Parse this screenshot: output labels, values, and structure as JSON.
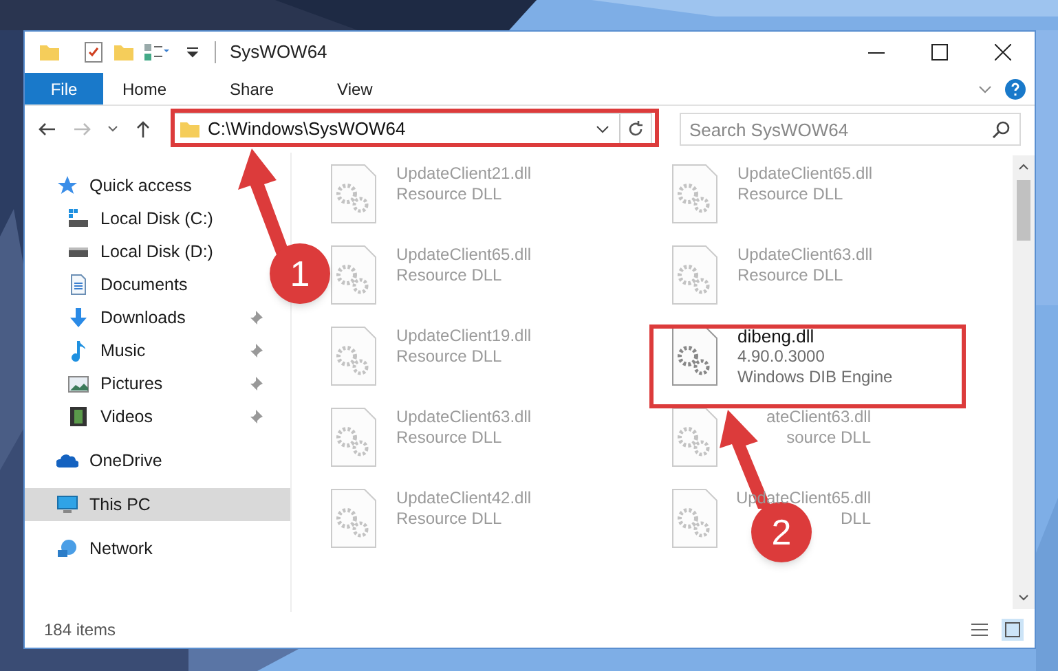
{
  "window": {
    "title": "SysWOW64"
  },
  "ribbon_tabs": [
    {
      "label": "File",
      "selected": true
    },
    {
      "label": "Home",
      "selected": false
    },
    {
      "label": "Share",
      "selected": false
    },
    {
      "label": "View",
      "selected": false
    }
  ],
  "address_bar": {
    "path": "C:\\Windows\\SysWOW64"
  },
  "search": {
    "placeholder": "Search SysWOW64"
  },
  "sidebar": {
    "items": [
      {
        "label": "Quick access",
        "kind": "star",
        "pinned": false,
        "selected": false,
        "children": [
          {
            "label": "Local Disk (C:)",
            "kind": "disk-c",
            "pinned": false,
            "selected": false
          },
          {
            "label": "Local Disk (D:)",
            "kind": "disk",
            "pinned": false,
            "selected": false
          },
          {
            "label": "Documents",
            "kind": "documents",
            "pinned": false,
            "selected": false
          },
          {
            "label": "Downloads",
            "kind": "downloads",
            "pinned": true,
            "selected": false
          },
          {
            "label": "Music",
            "kind": "music",
            "pinned": true,
            "selected": false
          },
          {
            "label": "Pictures",
            "kind": "pictures",
            "pinned": true,
            "selected": false
          },
          {
            "label": "Videos",
            "kind": "videos",
            "pinned": true,
            "selected": false
          }
        ]
      },
      {
        "label": "OneDrive",
        "kind": "cloud",
        "pinned": false,
        "selected": false
      },
      {
        "label": "This PC",
        "kind": "pc",
        "pinned": false,
        "selected": true
      },
      {
        "label": "Network",
        "kind": "network",
        "pinned": false,
        "selected": false
      }
    ]
  },
  "files": [
    {
      "name": "UpdateClient21.dll",
      "line_2": "Resource DLL",
      "faded": true,
      "covered": false
    },
    {
      "name": "UpdateClient65.dll",
      "line_2": "Resource DLL",
      "faded": true,
      "covered": false
    },
    {
      "name": "UpdateClient65.dll",
      "line_2": "Resource DLL",
      "faded": true,
      "covered": false
    },
    {
      "name": "UpdateClient63.dll",
      "line_2": "Resource DLL",
      "faded": true,
      "covered": false
    },
    {
      "name": "UpdateClient19.dll",
      "line_2": "Resource DLL",
      "faded": true,
      "covered": false
    },
    {
      "name": "dibeng.dll",
      "line_2": "4.90.0.3000",
      "line_3": "Windows DIB Engine",
      "faded": false,
      "covered": false
    },
    {
      "name": "UpdateClient63.dll",
      "line_2": "Resource DLL",
      "faded": true,
      "covered": false
    },
    {
      "name": "ateClient63.dll",
      "line_2": "source DLL",
      "faded": true,
      "covered": true
    },
    {
      "name": "UpdateClient42.dll",
      "line_2": "Resource DLL",
      "faded": true,
      "covered": false
    },
    {
      "name": "UpdateClient65.dll",
      "line_2": "DLL",
      "faded": true,
      "covered": true
    }
  ],
  "status_bar": {
    "item_count": "184 items"
  },
  "annotations": [
    {
      "number": "1"
    },
    {
      "number": "2"
    }
  ]
}
